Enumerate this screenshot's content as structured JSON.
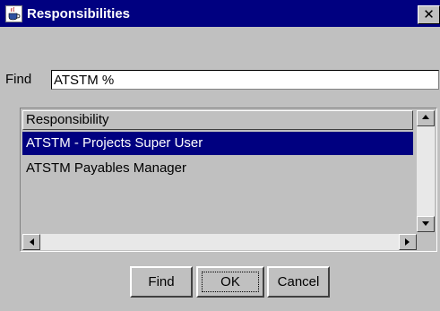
{
  "window": {
    "title": "Responsibilities",
    "close_label": "✕",
    "app_icon": "java-cup-icon"
  },
  "find": {
    "label": "Find",
    "value": "ATSTM %"
  },
  "list": {
    "column_header": "Responsibility",
    "rows": [
      {
        "label": "ATSTM - Projects Super User",
        "selected": true
      },
      {
        "label": "ATSTM Payables Manager",
        "selected": false
      }
    ]
  },
  "buttons": {
    "find": "Find",
    "ok": "OK",
    "cancel": "Cancel"
  },
  "colors": {
    "titlebar": "#000080",
    "selection": "#000080",
    "face": "#c0c0c0"
  }
}
